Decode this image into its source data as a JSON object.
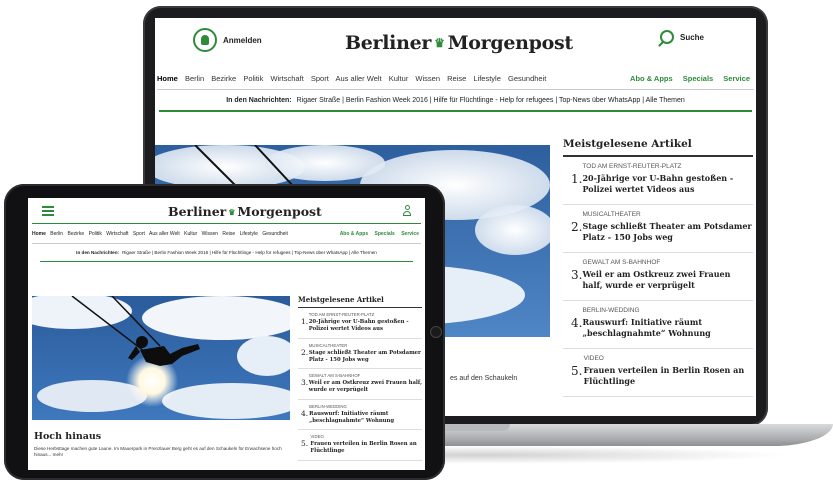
{
  "brand": {
    "name_left": "Berliner",
    "name_right": "Morgenpost",
    "accent": "#2e8b3c"
  },
  "header": {
    "login_label": "Anmelden",
    "search_label": "Suche"
  },
  "nav": {
    "items": [
      "Home",
      "Berlin",
      "Bezirke",
      "Politik",
      "Wirtschaft",
      "Sport",
      "Aus aller Welt",
      "Kultur",
      "Wissen",
      "Reise",
      "Lifestyle",
      "Gesundheit"
    ],
    "right": [
      "Abo & Apps",
      "Specials",
      "Service"
    ]
  },
  "news_bar": {
    "label": "In den Nachrichten:",
    "text": "Rigaer Straße | Berlin Fashion Week 2016 | Hilfe für Flüchtlinge - Help for refugees | Top-News über WhatsApp | Alle Themen"
  },
  "hero": {
    "title": "Hoch hinaus",
    "description": "Diese Herbsttage machen gute Laune. Im Mauerpark in Prenzlauer Berg geht es auf den Schaukeln für Erwachsene hoch hinaus... mehr",
    "laptop_caption": "es auf den Schaukeln"
  },
  "most_read": {
    "heading": "Meistgelesene Artikel",
    "items": [
      {
        "num": "1.",
        "kicker": "TOD AM ERNST-REUTER-PLATZ",
        "title": "20-Jährige vor U-Bahn gestoßen - Polizei wertet Videos aus"
      },
      {
        "num": "2.",
        "kicker": "MUSICALTHEATER",
        "title": "Stage schließt Theater am Potsdamer Platz - 150 Jobs weg"
      },
      {
        "num": "3.",
        "kicker": "GEWALT AM S-BAHNHOF",
        "title": "Weil er am Ostkreuz zwei Frauen half, wurde er verprügelt"
      },
      {
        "num": "4.",
        "kicker": "BERLIN-WEDDING",
        "title": "Rauswurf: Initiative räumt „beschlagnahmte“ Wohnung"
      },
      {
        "num": "5.",
        "kicker": "VIDEO",
        "title": "Frauen verteilen in Berlin Rosen an Flüchtlinge"
      }
    ]
  }
}
